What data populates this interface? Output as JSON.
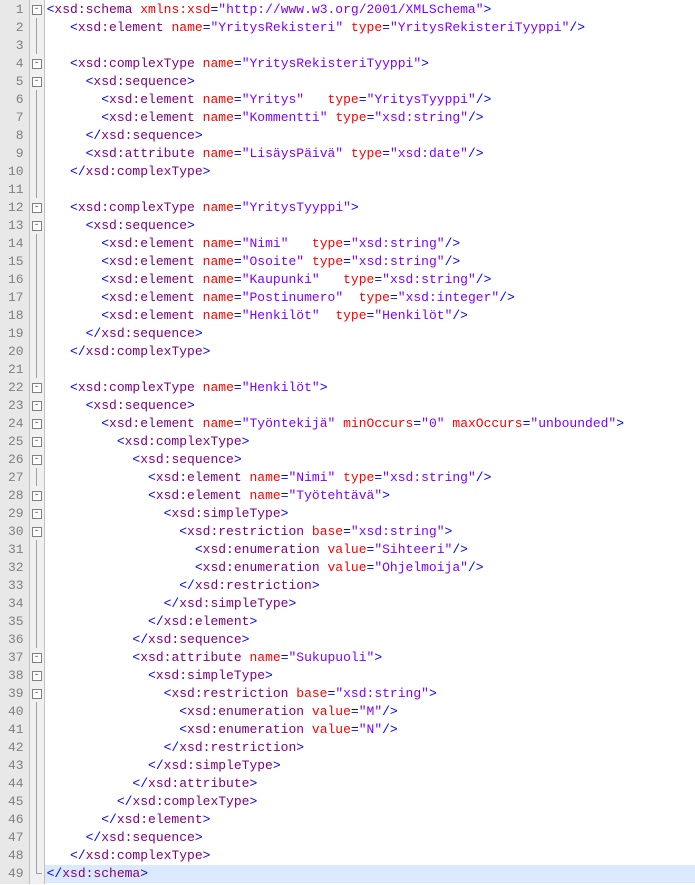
{
  "lineCount": 49,
  "highlightLine": 49,
  "fold": {
    "1": "open",
    "4": "open",
    "5": "open",
    "12": "open",
    "13": "open",
    "22": "open",
    "23": "open",
    "24": "open",
    "25": "open",
    "26": "open",
    "28": "open",
    "29": "open",
    "30": "open",
    "37": "open",
    "38": "open",
    "39": "open"
  },
  "foldCloses": {
    "49": true
  },
  "code": [
    [
      [
        "p",
        "<"
      ],
      [
        "el",
        "xsd:schema"
      ],
      [
        "p",
        " "
      ],
      [
        "an",
        "xmlns:xsd"
      ],
      [
        "p",
        "="
      ],
      [
        "av",
        "\"http://www.w3.org/2001/XMLSchema\""
      ],
      [
        "p",
        ">"
      ]
    ],
    [
      [
        "p",
        "   <"
      ],
      [
        "el",
        "xsd:element"
      ],
      [
        "p",
        " "
      ],
      [
        "an",
        "name"
      ],
      [
        "p",
        "="
      ],
      [
        "av",
        "\"YritysRekisteri\""
      ],
      [
        "p",
        " "
      ],
      [
        "an",
        "type"
      ],
      [
        "p",
        "="
      ],
      [
        "av",
        "\"YritysRekisteriTyyppi\""
      ],
      [
        "p",
        "/>"
      ]
    ],
    [
      [
        "p",
        ""
      ]
    ],
    [
      [
        "p",
        "   <"
      ],
      [
        "el",
        "xsd:complexType"
      ],
      [
        "p",
        " "
      ],
      [
        "an",
        "name"
      ],
      [
        "p",
        "="
      ],
      [
        "av",
        "\"YritysRekisteriTyyppi\""
      ],
      [
        "p",
        ">"
      ]
    ],
    [
      [
        "p",
        "     <"
      ],
      [
        "el",
        "xsd:sequence"
      ],
      [
        "p",
        ">"
      ]
    ],
    [
      [
        "p",
        "       <"
      ],
      [
        "el",
        "xsd:element"
      ],
      [
        "p",
        " "
      ],
      [
        "an",
        "name"
      ],
      [
        "p",
        "="
      ],
      [
        "av",
        "\"Yritys\""
      ],
      [
        "p",
        "   "
      ],
      [
        "an",
        "type"
      ],
      [
        "p",
        "="
      ],
      [
        "av",
        "\"YritysTyyppi\""
      ],
      [
        "p",
        "/>"
      ]
    ],
    [
      [
        "p",
        "       <"
      ],
      [
        "el",
        "xsd:element"
      ],
      [
        "p",
        " "
      ],
      [
        "an",
        "name"
      ],
      [
        "p",
        "="
      ],
      [
        "av",
        "\"Kommentti\""
      ],
      [
        "p",
        " "
      ],
      [
        "an",
        "type"
      ],
      [
        "p",
        "="
      ],
      [
        "av",
        "\"xsd:string\""
      ],
      [
        "p",
        "/>"
      ]
    ],
    [
      [
        "p",
        "     </"
      ],
      [
        "el",
        "xsd:sequence"
      ],
      [
        "p",
        ">"
      ]
    ],
    [
      [
        "p",
        "     <"
      ],
      [
        "el",
        "xsd:attribute"
      ],
      [
        "p",
        " "
      ],
      [
        "an",
        "name"
      ],
      [
        "p",
        "="
      ],
      [
        "av",
        "\"LisäysPäivä\""
      ],
      [
        "p",
        " "
      ],
      [
        "an",
        "type"
      ],
      [
        "p",
        "="
      ],
      [
        "av",
        "\"xsd:date\""
      ],
      [
        "p",
        "/>"
      ]
    ],
    [
      [
        "p",
        "   </"
      ],
      [
        "el",
        "xsd:complexType"
      ],
      [
        "p",
        ">"
      ]
    ],
    [
      [
        "p",
        ""
      ]
    ],
    [
      [
        "p",
        "   <"
      ],
      [
        "el",
        "xsd:complexType"
      ],
      [
        "p",
        " "
      ],
      [
        "an",
        "name"
      ],
      [
        "p",
        "="
      ],
      [
        "av",
        "\"YritysTyyppi\""
      ],
      [
        "p",
        ">"
      ]
    ],
    [
      [
        "p",
        "     <"
      ],
      [
        "el",
        "xsd:sequence"
      ],
      [
        "p",
        ">"
      ]
    ],
    [
      [
        "p",
        "       <"
      ],
      [
        "el",
        "xsd:element"
      ],
      [
        "p",
        " "
      ],
      [
        "an",
        "name"
      ],
      [
        "p",
        "="
      ],
      [
        "av",
        "\"Nimi\""
      ],
      [
        "p",
        "   "
      ],
      [
        "an",
        "type"
      ],
      [
        "p",
        "="
      ],
      [
        "av",
        "\"xsd:string\""
      ],
      [
        "p",
        "/>"
      ]
    ],
    [
      [
        "p",
        "       <"
      ],
      [
        "el",
        "xsd:element"
      ],
      [
        "p",
        " "
      ],
      [
        "an",
        "name"
      ],
      [
        "p",
        "="
      ],
      [
        "av",
        "\"Osoite\""
      ],
      [
        "p",
        " "
      ],
      [
        "an",
        "type"
      ],
      [
        "p",
        "="
      ],
      [
        "av",
        "\"xsd:string\""
      ],
      [
        "p",
        "/>"
      ]
    ],
    [
      [
        "p",
        "       <"
      ],
      [
        "el",
        "xsd:element"
      ],
      [
        "p",
        " "
      ],
      [
        "an",
        "name"
      ],
      [
        "p",
        "="
      ],
      [
        "av",
        "\"Kaupunki\""
      ],
      [
        "p",
        "   "
      ],
      [
        "an",
        "type"
      ],
      [
        "p",
        "="
      ],
      [
        "av",
        "\"xsd:string\""
      ],
      [
        "p",
        "/>"
      ]
    ],
    [
      [
        "p",
        "       <"
      ],
      [
        "el",
        "xsd:element"
      ],
      [
        "p",
        " "
      ],
      [
        "an",
        "name"
      ],
      [
        "p",
        "="
      ],
      [
        "av",
        "\"Postinumero\""
      ],
      [
        "p",
        "  "
      ],
      [
        "an",
        "type"
      ],
      [
        "p",
        "="
      ],
      [
        "av",
        "\"xsd:integer\""
      ],
      [
        "p",
        "/>"
      ]
    ],
    [
      [
        "p",
        "       <"
      ],
      [
        "el",
        "xsd:element"
      ],
      [
        "p",
        " "
      ],
      [
        "an",
        "name"
      ],
      [
        "p",
        "="
      ],
      [
        "av",
        "\"Henkilöt\""
      ],
      [
        "p",
        "  "
      ],
      [
        "an",
        "type"
      ],
      [
        "p",
        "="
      ],
      [
        "av",
        "\"Henkilöt\""
      ],
      [
        "p",
        "/>"
      ]
    ],
    [
      [
        "p",
        "     </"
      ],
      [
        "el",
        "xsd:sequence"
      ],
      [
        "p",
        ">"
      ]
    ],
    [
      [
        "p",
        "   </"
      ],
      [
        "el",
        "xsd:complexType"
      ],
      [
        "p",
        ">"
      ]
    ],
    [
      [
        "p",
        ""
      ]
    ],
    [
      [
        "p",
        "   <"
      ],
      [
        "el",
        "xsd:complexType"
      ],
      [
        "p",
        " "
      ],
      [
        "an",
        "name"
      ],
      [
        "p",
        "="
      ],
      [
        "av",
        "\"Henkilöt\""
      ],
      [
        "p",
        ">"
      ]
    ],
    [
      [
        "p",
        "     <"
      ],
      [
        "el",
        "xsd:sequence"
      ],
      [
        "p",
        ">"
      ]
    ],
    [
      [
        "p",
        "       <"
      ],
      [
        "el",
        "xsd:element"
      ],
      [
        "p",
        " "
      ],
      [
        "an",
        "name"
      ],
      [
        "p",
        "="
      ],
      [
        "av",
        "\"Työntekijä\""
      ],
      [
        "p",
        " "
      ],
      [
        "an",
        "minOccurs"
      ],
      [
        "p",
        "="
      ],
      [
        "av",
        "\"0\""
      ],
      [
        "p",
        " "
      ],
      [
        "an",
        "maxOccurs"
      ],
      [
        "p",
        "="
      ],
      [
        "av",
        "\"unbounded\""
      ],
      [
        "p",
        ">"
      ]
    ],
    [
      [
        "p",
        "         <"
      ],
      [
        "el",
        "xsd:complexType"
      ],
      [
        "p",
        ">"
      ]
    ],
    [
      [
        "p",
        "           <"
      ],
      [
        "el",
        "xsd:sequence"
      ],
      [
        "p",
        ">"
      ]
    ],
    [
      [
        "p",
        "             <"
      ],
      [
        "el",
        "xsd:element"
      ],
      [
        "p",
        " "
      ],
      [
        "an",
        "name"
      ],
      [
        "p",
        "="
      ],
      [
        "av",
        "\"Nimi\""
      ],
      [
        "p",
        " "
      ],
      [
        "an",
        "type"
      ],
      [
        "p",
        "="
      ],
      [
        "av",
        "\"xsd:string\""
      ],
      [
        "p",
        "/>"
      ]
    ],
    [
      [
        "p",
        "             <"
      ],
      [
        "el",
        "xsd:element"
      ],
      [
        "p",
        " "
      ],
      [
        "an",
        "name"
      ],
      [
        "p",
        "="
      ],
      [
        "av",
        "\"Työtehtävä\""
      ],
      [
        "p",
        ">"
      ]
    ],
    [
      [
        "p",
        "               <"
      ],
      [
        "el",
        "xsd:simpleType"
      ],
      [
        "p",
        ">"
      ]
    ],
    [
      [
        "p",
        "                 <"
      ],
      [
        "el",
        "xsd:restriction"
      ],
      [
        "p",
        " "
      ],
      [
        "an",
        "base"
      ],
      [
        "p",
        "="
      ],
      [
        "av",
        "\"xsd:string\""
      ],
      [
        "p",
        ">"
      ]
    ],
    [
      [
        "p",
        "                   <"
      ],
      [
        "el",
        "xsd:enumeration"
      ],
      [
        "p",
        " "
      ],
      [
        "an",
        "value"
      ],
      [
        "p",
        "="
      ],
      [
        "av",
        "\"Sihteeri\""
      ],
      [
        "p",
        "/>"
      ]
    ],
    [
      [
        "p",
        "                   <"
      ],
      [
        "el",
        "xsd:enumeration"
      ],
      [
        "p",
        " "
      ],
      [
        "an",
        "value"
      ],
      [
        "p",
        "="
      ],
      [
        "av",
        "\"Ohjelmoija\""
      ],
      [
        "p",
        "/>"
      ]
    ],
    [
      [
        "p",
        "                 </"
      ],
      [
        "el",
        "xsd:restriction"
      ],
      [
        "p",
        ">"
      ]
    ],
    [
      [
        "p",
        "               </"
      ],
      [
        "el",
        "xsd:simpleType"
      ],
      [
        "p",
        ">"
      ]
    ],
    [
      [
        "p",
        "             </"
      ],
      [
        "el",
        "xsd:element"
      ],
      [
        "p",
        ">"
      ]
    ],
    [
      [
        "p",
        "           </"
      ],
      [
        "el",
        "xsd:sequence"
      ],
      [
        "p",
        ">"
      ]
    ],
    [
      [
        "p",
        "           <"
      ],
      [
        "el",
        "xsd:attribute"
      ],
      [
        "p",
        " "
      ],
      [
        "an",
        "name"
      ],
      [
        "p",
        "="
      ],
      [
        "av",
        "\"Sukupuoli\""
      ],
      [
        "p",
        ">"
      ]
    ],
    [
      [
        "p",
        "             <"
      ],
      [
        "el",
        "xsd:simpleType"
      ],
      [
        "p",
        ">"
      ]
    ],
    [
      [
        "p",
        "               <"
      ],
      [
        "el",
        "xsd:restriction"
      ],
      [
        "p",
        " "
      ],
      [
        "an",
        "base"
      ],
      [
        "p",
        "="
      ],
      [
        "av",
        "\"xsd:string\""
      ],
      [
        "p",
        ">"
      ]
    ],
    [
      [
        "p",
        "                 <"
      ],
      [
        "el",
        "xsd:enumeration"
      ],
      [
        "p",
        " "
      ],
      [
        "an",
        "value"
      ],
      [
        "p",
        "="
      ],
      [
        "av",
        "\"M\""
      ],
      [
        "p",
        "/>"
      ]
    ],
    [
      [
        "p",
        "                 <"
      ],
      [
        "el",
        "xsd:enumeration"
      ],
      [
        "p",
        " "
      ],
      [
        "an",
        "value"
      ],
      [
        "p",
        "="
      ],
      [
        "av",
        "\"N\""
      ],
      [
        "p",
        "/>"
      ]
    ],
    [
      [
        "p",
        "               </"
      ],
      [
        "el",
        "xsd:restriction"
      ],
      [
        "p",
        ">"
      ]
    ],
    [
      [
        "p",
        "             </"
      ],
      [
        "el",
        "xsd:simpleType"
      ],
      [
        "p",
        ">"
      ]
    ],
    [
      [
        "p",
        "           </"
      ],
      [
        "el",
        "xsd:attribute"
      ],
      [
        "p",
        ">"
      ]
    ],
    [
      [
        "p",
        "         </"
      ],
      [
        "el",
        "xsd:complexType"
      ],
      [
        "p",
        ">"
      ]
    ],
    [
      [
        "p",
        "       </"
      ],
      [
        "el",
        "xsd:element"
      ],
      [
        "p",
        ">"
      ]
    ],
    [
      [
        "p",
        "     </"
      ],
      [
        "el",
        "xsd:sequence"
      ],
      [
        "p",
        ">"
      ]
    ],
    [
      [
        "p",
        "   </"
      ],
      [
        "el",
        "xsd:complexType"
      ],
      [
        "p",
        ">"
      ]
    ],
    [
      [
        "p",
        "</"
      ],
      [
        "el",
        "xsd:schema"
      ],
      [
        "p",
        ">"
      ]
    ]
  ]
}
